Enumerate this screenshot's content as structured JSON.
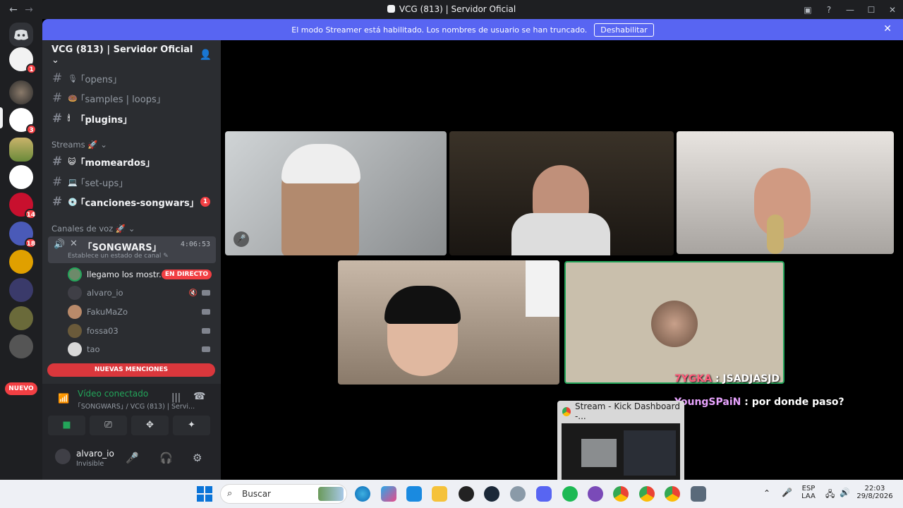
{
  "window": {
    "title": "VCG (813) | Servidor Oficial",
    "back_icon": "←",
    "forward_icon": "→"
  },
  "banner": {
    "text": "El modo Streamer está habilitado. Los nombres de usuario se han truncado.",
    "button": "Deshabilitar"
  },
  "servers": {
    "badges": [
      "1",
      "3",
      "14",
      "18"
    ],
    "nuevo": "NUEVO"
  },
  "server": {
    "name": "VCG (813) | Servidor Oficial"
  },
  "channels": [
    {
      "label": "｢opens｣",
      "emoji": "🎙",
      "unread": false
    },
    {
      "label": "｢samples | loops｣",
      "emoji": "🍩",
      "unread": false
    },
    {
      "label": "｢plugins｣",
      "emoji": "🕯",
      "unread": true
    }
  ],
  "streams": {
    "category": "Streams",
    "channels": [
      {
        "label": "｢momeardos｣",
        "emoji": "😺",
        "unread": true,
        "count": ""
      },
      {
        "label": "｢set-ups｣",
        "emoji": "💻",
        "unread": false,
        "count": ""
      },
      {
        "label": "｢canciones-songwars｣",
        "emoji": "💿",
        "unread": true,
        "count": "1"
      }
    ]
  },
  "voice": {
    "category": "Canales de voz",
    "channel": "｢SONGWARS｣",
    "time": "4:06:53",
    "status": "Establece un estado de canal",
    "users": [
      {
        "name": "llegamo los mostr...",
        "badge": "EN DIRECTO",
        "color": "#6d8a6a"
      },
      {
        "name": "alvaro_io",
        "badge": "",
        "color": "#3f3f46"
      },
      {
        "name": "FakuMaZo",
        "badge": "",
        "color": "#b98a6a"
      },
      {
        "name": "fossa03",
        "badge": "",
        "color": "#6a5a3a"
      },
      {
        "name": "tao",
        "badge": "",
        "color": "#d8d8d8"
      }
    ]
  },
  "mentions": "NUEVAS MENCIONES",
  "voice_panel": {
    "connected": "Vídeo conectado",
    "sub": "｢SONGWARS｣ / VCG (813) | Servi..."
  },
  "user": {
    "name": "alvaro_io",
    "status": "Invisible"
  },
  "chat": [
    {
      "user": "7YGKA",
      "message": ": JSADJASJD"
    },
    {
      "user": "YoungSPaiN",
      "message": ": por donde paso?"
    }
  ],
  "pip": {
    "title": "Stream - Kick Dashboard -..."
  },
  "taskbar": {
    "search": "Buscar",
    "lang1": "ESP",
    "lang2": "LAA",
    "time": "22:03",
    "date": "29/8/2026"
  }
}
